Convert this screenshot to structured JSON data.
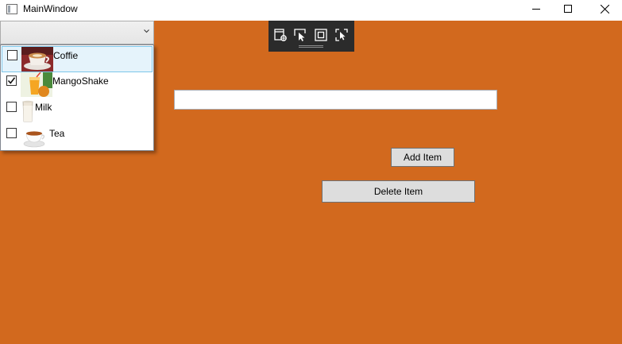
{
  "window": {
    "title": "MainWindow",
    "background_color": "#d2691e"
  },
  "combo": {
    "selected_text": "",
    "items": [
      {
        "label": "Coffie",
        "checked": false,
        "icon": "coffee-cup-icon"
      },
      {
        "label": "MangoShake",
        "checked": true,
        "icon": "mango-shake-icon"
      },
      {
        "label": "Milk",
        "checked": false,
        "icon": "milk-glass-icon"
      },
      {
        "label": "Tea",
        "checked": false,
        "icon": "tea-cup-icon"
      }
    ]
  },
  "debug_toolbar": {
    "icons": [
      "live-visual-tree-icon",
      "select-element-icon",
      "display-layout-adorners-icon",
      "track-focused-element-icon"
    ]
  },
  "item_input": {
    "value": ""
  },
  "buttons": {
    "add_label": "Add Item",
    "delete_label": "Delete Item"
  }
}
